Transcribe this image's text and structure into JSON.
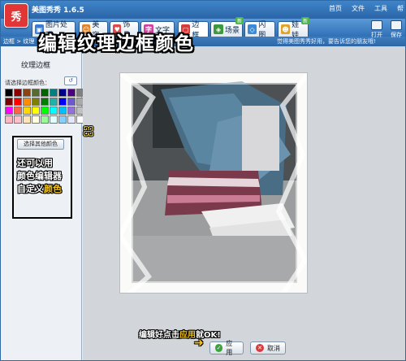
{
  "app": {
    "logo": "秀",
    "title": "美图秀秀 1.6.5"
  },
  "sysmenu": [
    "首页",
    "文件",
    "工具",
    "帮"
  ],
  "tabs": [
    {
      "label": "图片处理",
      "icon": "image-icon",
      "color": "#3a7bd5",
      "glyph": "▣",
      "active": false,
      "new": ""
    },
    {
      "label": "美容",
      "icon": "face-icon",
      "color": "#e0832b",
      "glyph": "☺",
      "active": false,
      "new": ""
    },
    {
      "label": "饰品",
      "icon": "heart-icon",
      "color": "#e04a4a",
      "glyph": "♥",
      "active": false,
      "new": ""
    },
    {
      "label": "文字",
      "icon": "text-icon",
      "color": "#d33ea0",
      "glyph": "字",
      "active": false,
      "new": ""
    },
    {
      "label": "边框",
      "icon": "frame-icon",
      "color": "#d93b3b",
      "glyph": "▢",
      "active": true,
      "new": ""
    },
    {
      "label": "场景",
      "icon": "scene-icon",
      "color": "#3c9a3c",
      "glyph": "◈",
      "active": false,
      "new": "新"
    },
    {
      "label": "闪图",
      "icon": "flash-icon",
      "color": "#3a8ad5",
      "glyph": "◇",
      "active": false,
      "new": ""
    },
    {
      "label": "娃娃",
      "icon": "doll-icon",
      "color": "#e0a32b",
      "glyph": "☻",
      "active": false,
      "new": "新"
    }
  ],
  "right_tools": [
    "打开",
    "保存"
  ],
  "subbar": {
    "crumb": "边框 > 纹理",
    "promo": "觉得美图秀秀好用，要告诉您的朋友哦!"
  },
  "headline": "编辑纹理边框颜色",
  "panel": {
    "title": "纹理边框",
    "choose_label": "请选择边框颜色：",
    "reset_glyph": "↺",
    "swirl": "ஐ",
    "other_color_button": "选择其他颜色",
    "tip_lines": [
      "还可以用",
      "颜色编辑器",
      "自定义",
      "颜色"
    ]
  },
  "swatch_colors": [
    "#000000",
    "#8b0000",
    "#8b4513",
    "#556b2f",
    "#006400",
    "#008080",
    "#00008b",
    "#4b0082",
    "#808080",
    "#800000",
    "#ff0000",
    "#ff8c00",
    "#808000",
    "#008000",
    "#20b2aa",
    "#0000ff",
    "#6a5acd",
    "#a9a9a9",
    "#ff00ff",
    "#ff6347",
    "#ffd700",
    "#ffff00",
    "#00ff00",
    "#00ffff",
    "#00bfff",
    "#9370db",
    "#c0c0c0",
    "#ffb6c1",
    "#ffc0cb",
    "#ffe4b5",
    "#ffffe0",
    "#98fb98",
    "#e0ffff",
    "#87cefa",
    "#e6e6fa",
    "#ffffff"
  ],
  "bottom_note": {
    "a": "编辑好点击",
    "b": "应用",
    "c": "就OK!"
  },
  "arrow": "➜",
  "buttons": {
    "apply": "应用",
    "cancel": "取消"
  }
}
